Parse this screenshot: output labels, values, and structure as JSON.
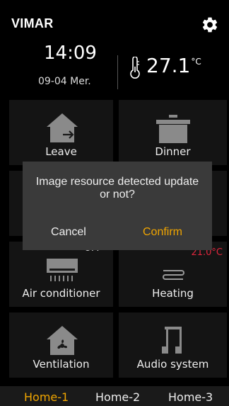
{
  "header": {
    "brand": "VIMAR",
    "icon": "gear-icon"
  },
  "clock": {
    "time": "14:09",
    "date": "09-04 Mer."
  },
  "weather": {
    "icon": "thermometer-icon",
    "temperature": "27.1",
    "unit": "°C"
  },
  "tiles": {
    "leave": {
      "label": "Leave",
      "icon": "house-exit-icon"
    },
    "dinner": {
      "label": "Dinner",
      "icon": "pot-icon"
    },
    "air_conditioner": {
      "label": "Air conditioner",
      "icon": "air-conditioner-icon",
      "state": "OFF"
    },
    "heating": {
      "label": "Heating",
      "icon": "radiator-icon",
      "state": "21.0°C",
      "state_color": "#e0263d"
    },
    "ventilation": {
      "label": "Ventilation",
      "icon": "house-fan-icon"
    },
    "audio": {
      "label": "Audio system",
      "icon": "music-note-icon"
    }
  },
  "dialog": {
    "message": "Image resource detected update or not?",
    "cancel_label": "Cancel",
    "confirm_label": "Confirm",
    "confirm_color": "#f0a500"
  },
  "homes": {
    "tabs": [
      "Home-1",
      "Home-2",
      "Home-3"
    ],
    "active_color": "#f0a500"
  }
}
